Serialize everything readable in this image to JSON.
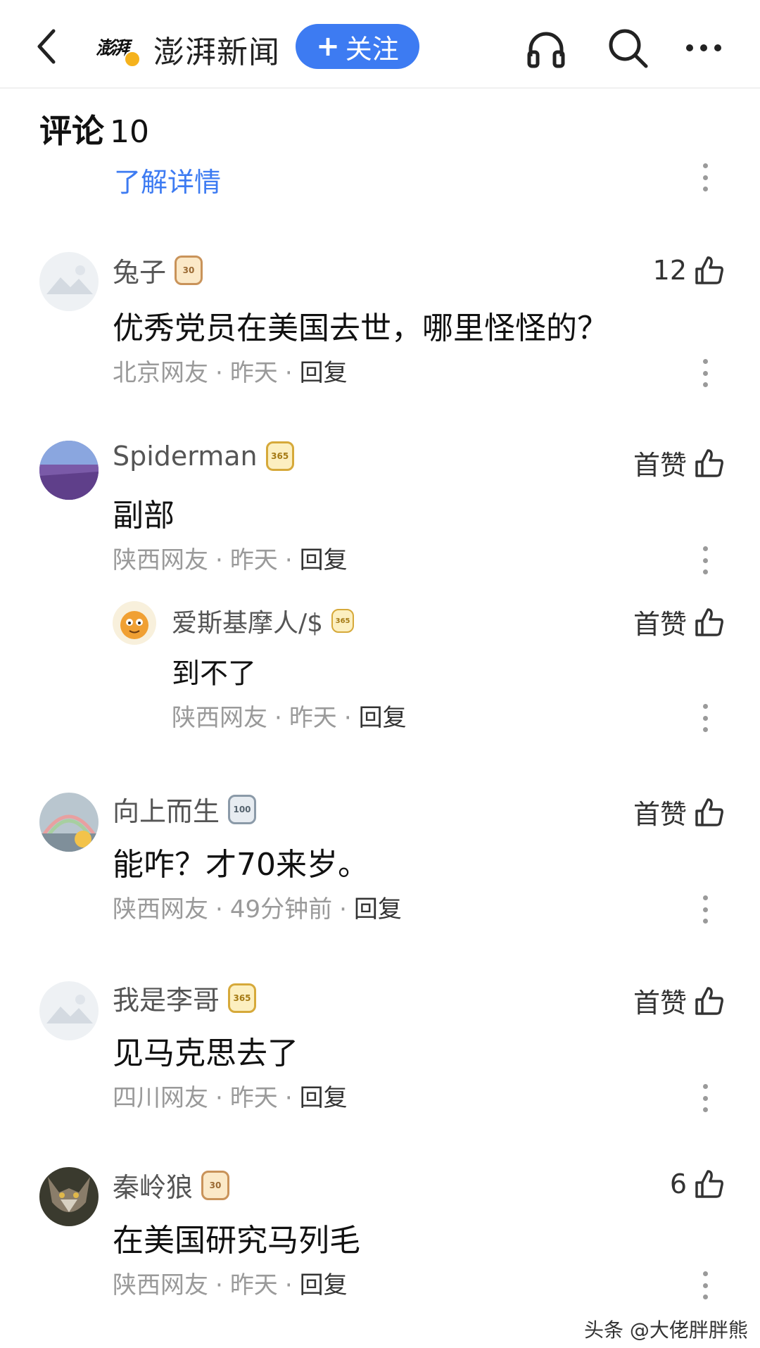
{
  "topbar": {
    "source_logo_text": "澎湃",
    "source_name": "澎湃新闻",
    "follow_label": "关注",
    "follow_plus": "+"
  },
  "header": {
    "title": "评论",
    "count": "10",
    "learn_more": "了解详情"
  },
  "comments": [
    {
      "name": "兔子",
      "badge": "30",
      "text": "优秀党员在美国去世，哪里怪怪的？",
      "region": "北京网友",
      "time": "昨天",
      "reply": "回复",
      "likes": "12"
    },
    {
      "name": "Spiderman",
      "badge": "365",
      "text": "副部",
      "region": "陕西网友",
      "time": "昨天",
      "reply": "回复",
      "likes": "首赞"
    },
    {
      "name": "爱斯基摩人/$",
      "badge": "365",
      "text": "到不了",
      "region": "陕西网友",
      "time": "昨天",
      "reply": "回复",
      "likes": "首赞"
    },
    {
      "name": "向上而生",
      "badge": "100",
      "text": "能咋？才70来岁。",
      "region": "陕西网友",
      "time": "49分钟前",
      "reply": "回复",
      "likes": "首赞"
    },
    {
      "name": "我是李哥",
      "badge": "365",
      "text": "见马克思去了",
      "region": "四川网友",
      "time": "昨天",
      "reply": "回复",
      "likes": "首赞"
    },
    {
      "name": "秦岭狼",
      "badge": "30",
      "text": "在美国研究马列毛",
      "region": "陕西网友",
      "time": "昨天",
      "reply": "回复",
      "likes": "6"
    }
  ],
  "separator": "·",
  "watermark": "头条 @大佬胖胖熊",
  "colors": {
    "accent": "#3d7bf2",
    "meta": "#9a9a9a"
  }
}
